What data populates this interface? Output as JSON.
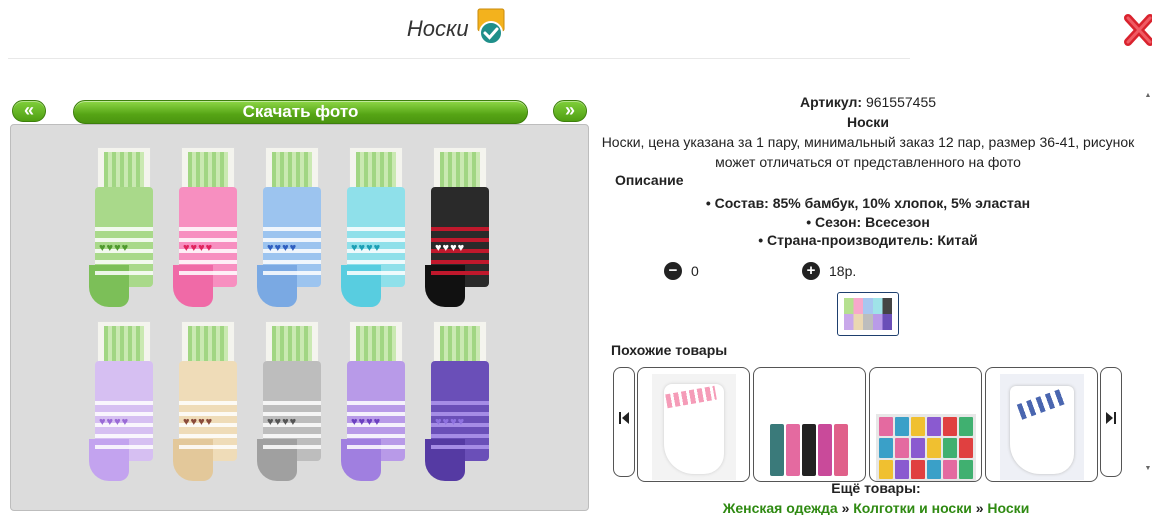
{
  "header": {
    "title": "Носки"
  },
  "gallery": {
    "prev_label": "«",
    "next_label": "»",
    "download_label": "Скачать фото"
  },
  "product": {
    "article_label": "Артикул:",
    "article_value": "961557455",
    "name": "Носки",
    "description": "Носки, цена указана за 1 пару, минимальный заказ 12 пар, размер 36-41, рисунок может отличаться от представленного на фото",
    "description_heading": "Описание",
    "properties": [
      "Состав: 85% бамбук, 10% хлопок, 5% эластан",
      "Сезон: Всесезон",
      "Страна-производитель: Китай"
    ]
  },
  "quantity": {
    "minus": "−",
    "value": "0",
    "plus": "+",
    "step_label": "18р."
  },
  "similar": {
    "heading": "Похожие товары",
    "prev_icon": "skip-back-icon",
    "next_icon": "skip-forward-icon"
  },
  "more": {
    "heading": "Ещё товары:",
    "crumbs": [
      "Женская одежда",
      "Колготки и носки",
      "Носки"
    ],
    "separator": "»"
  },
  "colors": {
    "accent_green": "#56a515",
    "link_green": "#2f8a12",
    "close_red": "#d9232e"
  }
}
